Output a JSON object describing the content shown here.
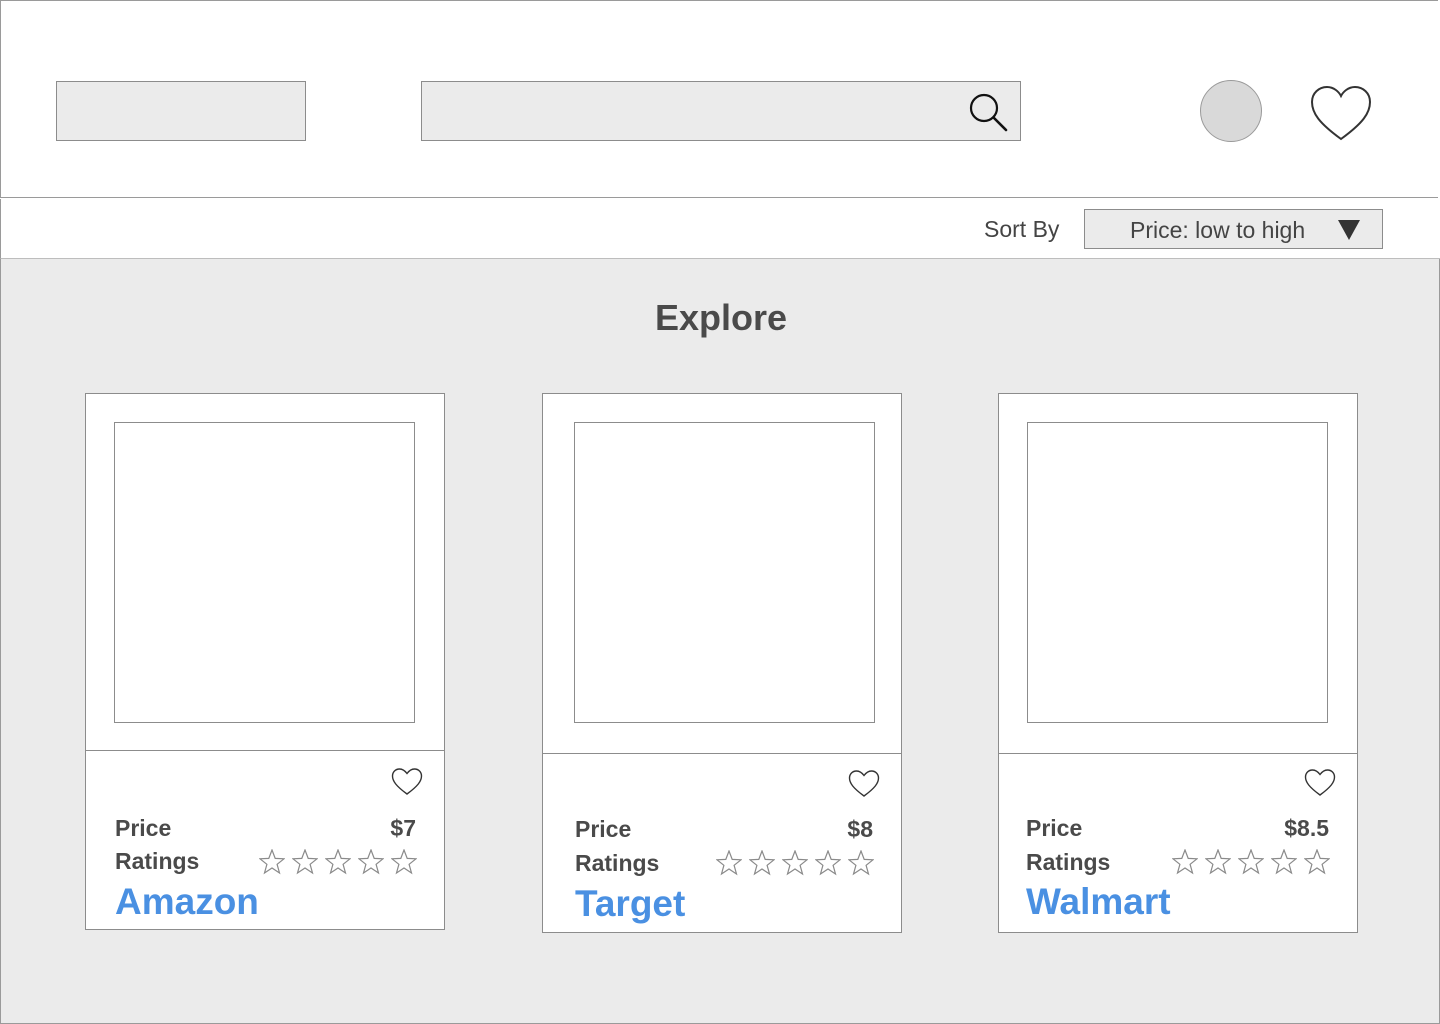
{
  "header": {
    "search_placeholder": ""
  },
  "sort": {
    "label": "Sort By",
    "selected": "Price: low to high"
  },
  "main": {
    "title": "Explore"
  },
  "products": [
    {
      "store": "Amazon",
      "price_label": "Price",
      "price": "$7",
      "ratings_label": "Ratings",
      "rating": 0,
      "max_rating": 5
    },
    {
      "store": "Target",
      "price_label": "Price",
      "price": "$8",
      "ratings_label": "Ratings",
      "rating": 0,
      "max_rating": 5
    },
    {
      "store": "Walmart",
      "price_label": "Price",
      "price": "$8.5",
      "ratings_label": "Ratings",
      "rating": 0,
      "max_rating": 5
    }
  ],
  "colors": {
    "link": "#4a90e2",
    "panel": "#ebebeb",
    "border": "#8c8c8c"
  },
  "icons": [
    "search-icon",
    "avatar",
    "heart-icon",
    "dropdown-caret-icon",
    "star-icon"
  ]
}
